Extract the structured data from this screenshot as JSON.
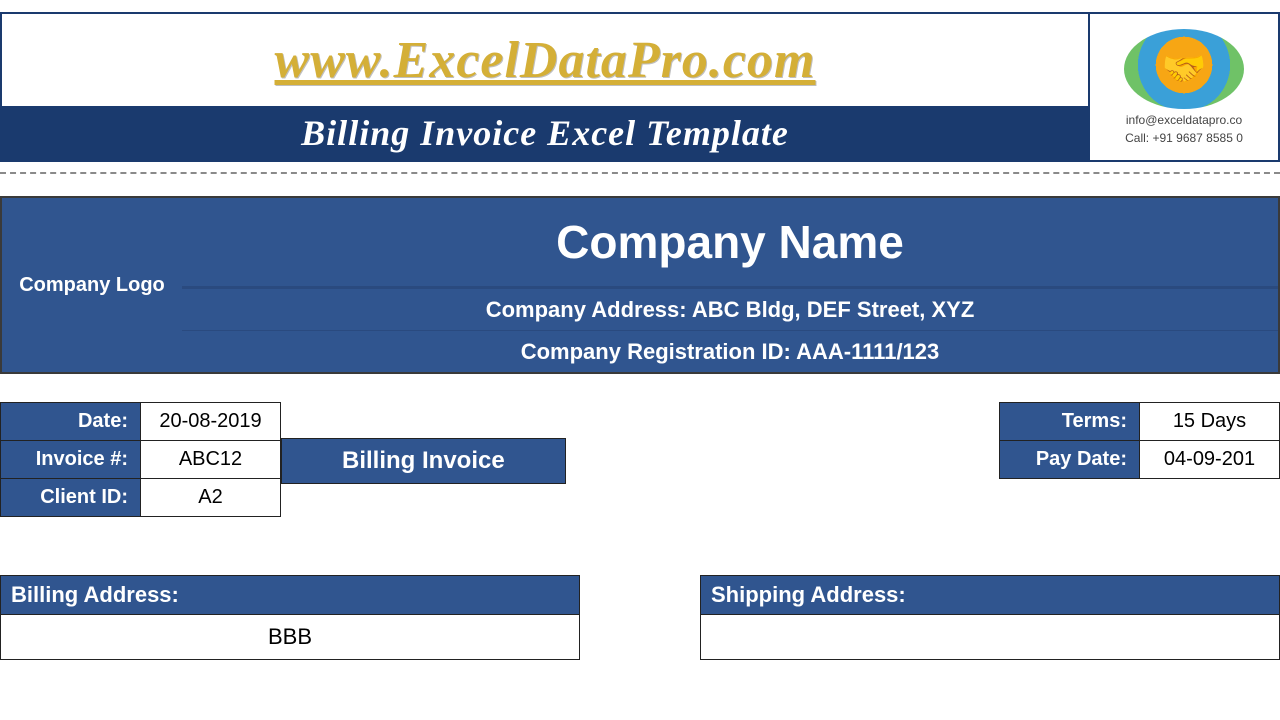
{
  "banner": {
    "url": "www.ExcelDataPro.com",
    "title": "Billing Invoice Excel Template",
    "contact_email": "info@exceldatapro.co",
    "contact_phone": "Call: +91 9687 8585 0"
  },
  "company": {
    "logo_label": "Company Logo",
    "name": "Company Name",
    "address": "Company Address: ABC Bldg, DEF Street, XYZ",
    "registration": "Company Registration ID: AAA-1111/123"
  },
  "left_fields": {
    "date_label": "Date:",
    "date_value": "20-08-2019",
    "invoice_label": "Invoice #:",
    "invoice_value": "ABC12",
    "client_label": "Client ID:",
    "client_value": "A2"
  },
  "doc_title": "Billing Invoice",
  "right_fields": {
    "terms_label": "Terms:",
    "terms_value": "15 Days",
    "paydate_label": "Pay Date:",
    "paydate_value": "04-09-201"
  },
  "addresses": {
    "billing_label": "Billing Address:",
    "billing_value": "BBB",
    "shipping_label": "Shipping Address:",
    "shipping_value": ""
  }
}
